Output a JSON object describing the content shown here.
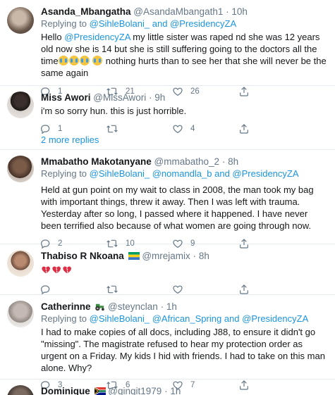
{
  "tweets": [
    {
      "name": "Asanda_Mbangatha",
      "handle": "@AsandaMbangath1",
      "dot": "·",
      "time": "10h",
      "reply_prefix": "Replying to ",
      "reply_to": "@SihleBolani_ and @PresidencyZA",
      "text_prefix": "Hello ",
      "mention": "@PresidencyZA",
      "text_line1_rest": " my little sister was raped nd she was 12 years old now she is 14 but she is still suffering going to the doctors all the time",
      "text_line2_rest": " nothing hurts than to see her that she will never be the same again",
      "counts": {
        "reply": "1",
        "retweet": "21",
        "like": "26"
      }
    },
    {
      "name": "Miss Awori",
      "handle": "@MissAwori",
      "dot": "·",
      "time": "9h",
      "text": "i'm so sorry hun. this is just horrible.",
      "counts": {
        "reply": "1",
        "retweet": "",
        "like": "4"
      }
    },
    {
      "name": "Mmabatho Makotanyane",
      "handle": "@mmabatho_2",
      "dot": "·",
      "time": "8h",
      "reply_prefix": "Replying to ",
      "reply_to": "@SihleBolani_ @nomandla_b and @PresidencyZA",
      "text": "Held at gun point on my wait to class in 2008, the man took my bag with important things, threw it away. Then I was left with trauma. Yesterday after so long, I passed where it happened. I have never been terrified also because of what women are going through now.",
      "counts": {
        "reply": "2",
        "retweet": "10",
        "like": "9"
      }
    },
    {
      "name": "Thabiso R Nkoana",
      "handle": "@mrejamix",
      "dot": "·",
      "time": "8h",
      "counts": {
        "reply": "",
        "retweet": "",
        "like": ""
      }
    },
    {
      "name": "Catherinne",
      "handle": "@steynclan",
      "dot": "·",
      "time": "1h",
      "reply_prefix": "Replying to ",
      "reply_to": "@SihleBolani_ @African_Spring and @PresidencyZA",
      "text": "I had to make copies of all docs, including J88, to ensure it didn't go \"missing\". The magistrate refused to hear my protection order as urgent on a Friday. My kids I hid with friends. I had to take on this man alone. Why?",
      "counts": {
        "reply": "3",
        "retweet": "6",
        "like": "7"
      }
    },
    {
      "name": "Dominique",
      "handle": "@qinqit1979",
      "dot": "·",
      "time": "1h"
    }
  ],
  "more_replies_label": "2 more replies",
  "colors": {
    "link": "#1b95e0",
    "muted": "#657786",
    "border": "#e6ecf0"
  },
  "icons": [
    "reply-icon",
    "retweet-icon",
    "like-icon",
    "share-icon",
    "broken-heart-icon",
    "crying-face-icon",
    "gabon-flag-icon",
    "tractor-icon",
    "south-africa-flag-icon"
  ]
}
